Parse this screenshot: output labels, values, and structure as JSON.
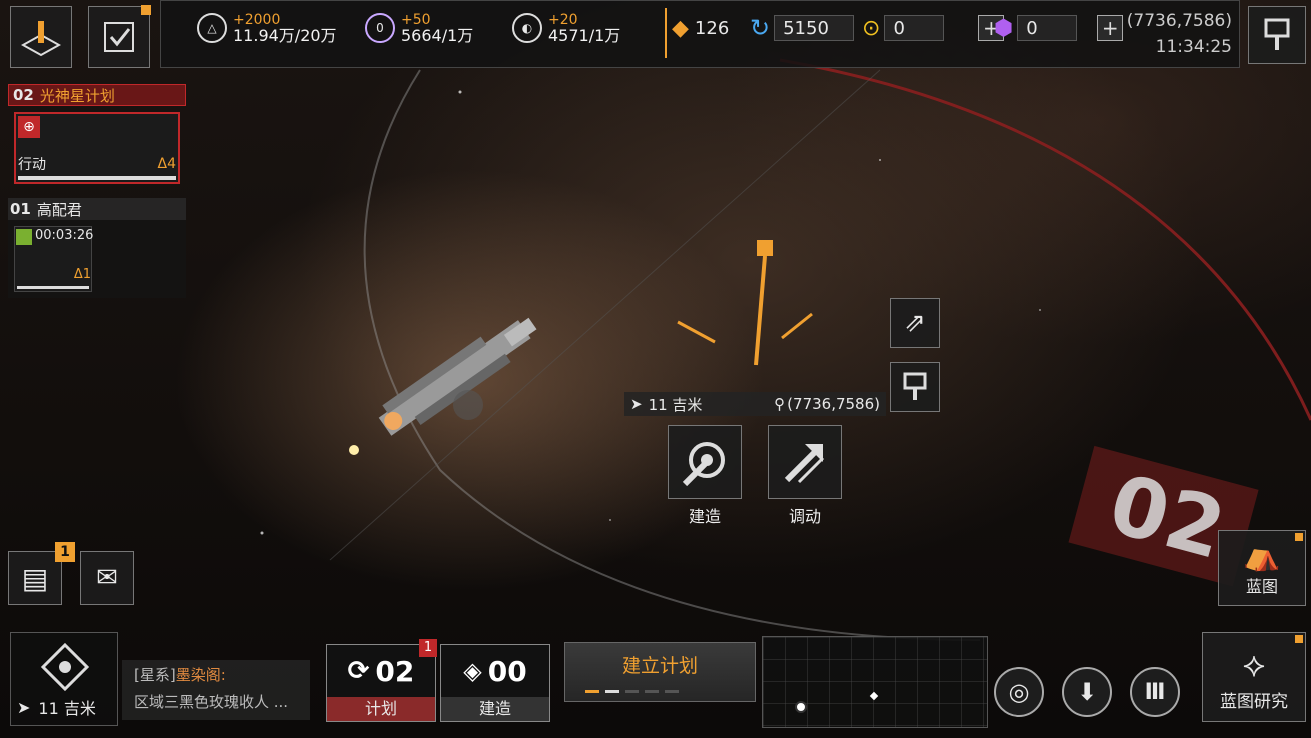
{
  "top_left": {
    "build_badge": "",
    "tasks_badge": ""
  },
  "resources": [
    {
      "icon": "triangle-ore-icon",
      "gain": "+2000",
      "value": "11.94万/20万"
    },
    {
      "icon": "crystal-icon",
      "gain": "+50",
      "value": "5664/1万"
    },
    {
      "icon": "heavy-water-icon",
      "gain": "+20",
      "value": "4571/1万"
    }
  ],
  "currencies": {
    "upgrade": "126",
    "recycle": "5150",
    "gold": "0",
    "purple": "0"
  },
  "coords": {
    "position": "(7736,7586)",
    "time": "11:34:25"
  },
  "fleets": [
    {
      "index": "02",
      "name": "光神星计划",
      "status": "行动",
      "tier": "Δ4"
    },
    {
      "index": "01",
      "name": "高配君",
      "timer": "00:03:26",
      "tier": "Δ1"
    }
  ],
  "map": {
    "distance": "11 吉米",
    "target_coords": "(7736,7586)",
    "build_label": "建造",
    "dispatch_label": "调动",
    "zone_label": "02"
  },
  "side": {
    "blueprint_label": "蓝图",
    "mail_badge": "1"
  },
  "bottom": {
    "base_distance": "11 吉米",
    "chat_channel": "[星系]",
    "chat_user": "墨染阁:",
    "chat_message": "区域三黑色玫瑰收人 ...",
    "plan_count": "02",
    "plan_label": "计划",
    "plan_badge": "1",
    "build_count": "00",
    "build_label": "建造",
    "establish_label": "建立计划",
    "research_label": "蓝图研究"
  },
  "colors": {
    "accent": "#f0a030",
    "alert": "#c0282a"
  }
}
